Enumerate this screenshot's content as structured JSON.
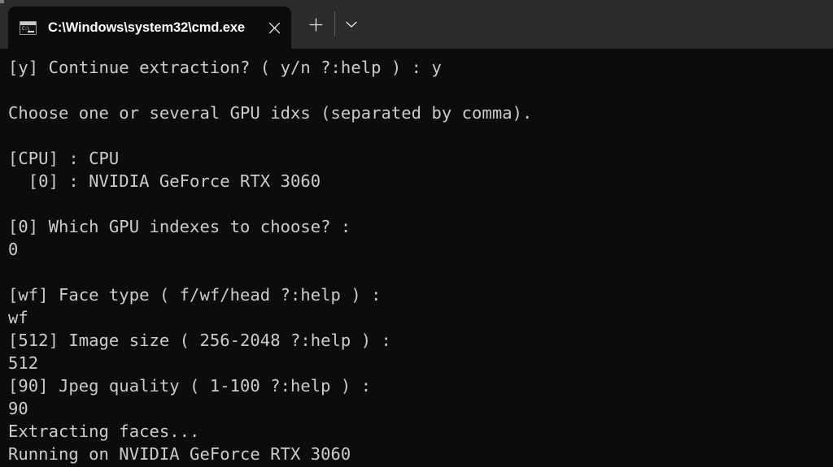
{
  "window": {
    "titlebar_color": "#2b2b2b",
    "body_color": "#0c0c0c",
    "text_color": "#cccccc"
  },
  "tab": {
    "title": "C:\\Windows\\system32\\cmd.exe",
    "icon": "cmd-console-icon",
    "icon_prompt_text": "C:\\",
    "close_label": "✕"
  },
  "tabbar": {
    "new_tab_label": "+",
    "dropdown_label": "⌄"
  },
  "terminal": {
    "lines": [
      "[y] Continue extraction? ( y/n ?:help ) : y",
      "",
      "Choose one or several GPU idxs (separated by comma).",
      "",
      "[CPU] : CPU",
      "  [0] : NVIDIA GeForce RTX 3060",
      "",
      "[0] Which GPU indexes to choose? :",
      "0",
      "",
      "[wf] Face type ( f/wf/head ?:help ) :",
      "wf",
      "[512] Image size ( 256-2048 ?:help ) :",
      "512",
      "[90] Jpeg quality ( 1-100 ?:help ) :",
      "90",
      "Extracting faces...",
      "Running on NVIDIA GeForce RTX 3060"
    ]
  }
}
